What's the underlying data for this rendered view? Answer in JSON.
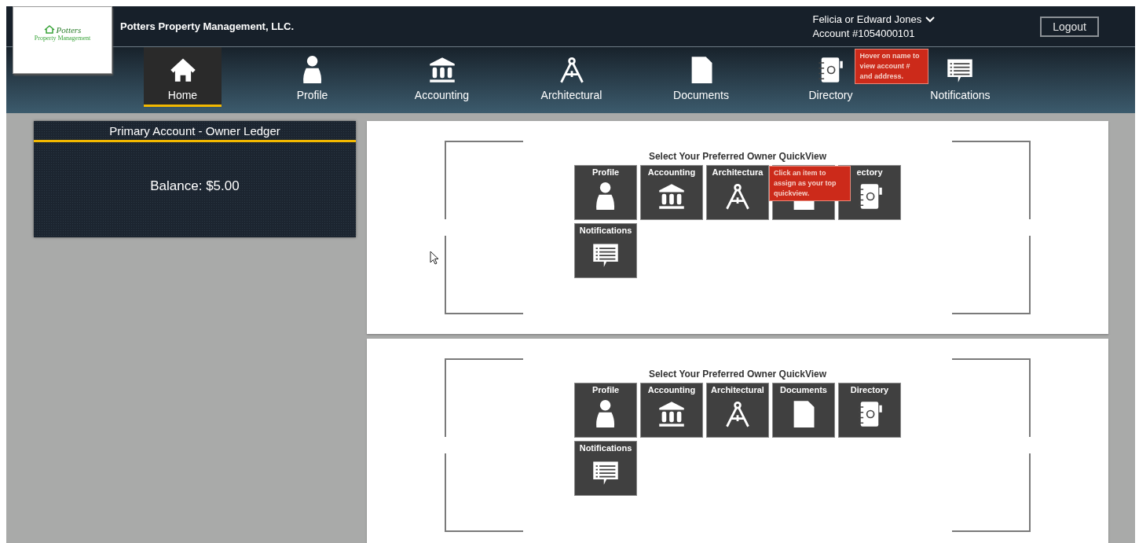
{
  "header": {
    "logo": {
      "name": "Potters",
      "tagline": "Property Management"
    },
    "company": "Potters Property Management, LLC.",
    "user": {
      "name": "Felicia or Edward Jones",
      "account": "Account #1054000101"
    },
    "tooltip": "Hover on name to view account # and address.",
    "logout": "Logout"
  },
  "nav": [
    {
      "label": "Home",
      "kind": "home",
      "selected": true
    },
    {
      "label": "Profile",
      "kind": "person",
      "selected": false
    },
    {
      "label": "Accounting",
      "kind": "bank",
      "selected": false
    },
    {
      "label": "Architectural",
      "kind": "compass",
      "selected": false
    },
    {
      "label": "Documents",
      "kind": "document",
      "selected": false
    },
    {
      "label": "Directory",
      "kind": "directory",
      "selected": false
    },
    {
      "label": "Notifications",
      "kind": "notifications",
      "selected": false
    }
  ],
  "ledger": {
    "title": "Primary Account - Owner Ledger",
    "balance": "Balance: $5.00"
  },
  "quickviews": [
    {
      "title": "Select Your Preferred Owner QuickView",
      "tooltip": "Click an item to assign as your top quickview.",
      "tiles": [
        {
          "label": "Profile",
          "kind": "person"
        },
        {
          "label": "Accounting",
          "kind": "bank"
        },
        {
          "label": "Architectura",
          "kind": "compass"
        },
        {
          "kind": "document"
        },
        {
          "label": "ectory",
          "kind": "directory"
        },
        {
          "label": "Notifications",
          "kind": "notifications"
        }
      ]
    },
    {
      "title": "Select Your Preferred Owner QuickView",
      "tiles": [
        {
          "label": "Profile",
          "kind": "person"
        },
        {
          "label": "Accounting",
          "kind": "bank"
        },
        {
          "label": "Architectural",
          "kind": "compass"
        },
        {
          "label": "Documents",
          "kind": "document"
        },
        {
          "label": "Directory",
          "kind": "directory"
        },
        {
          "label": "Notifications",
          "kind": "notifications"
        }
      ]
    }
  ]
}
